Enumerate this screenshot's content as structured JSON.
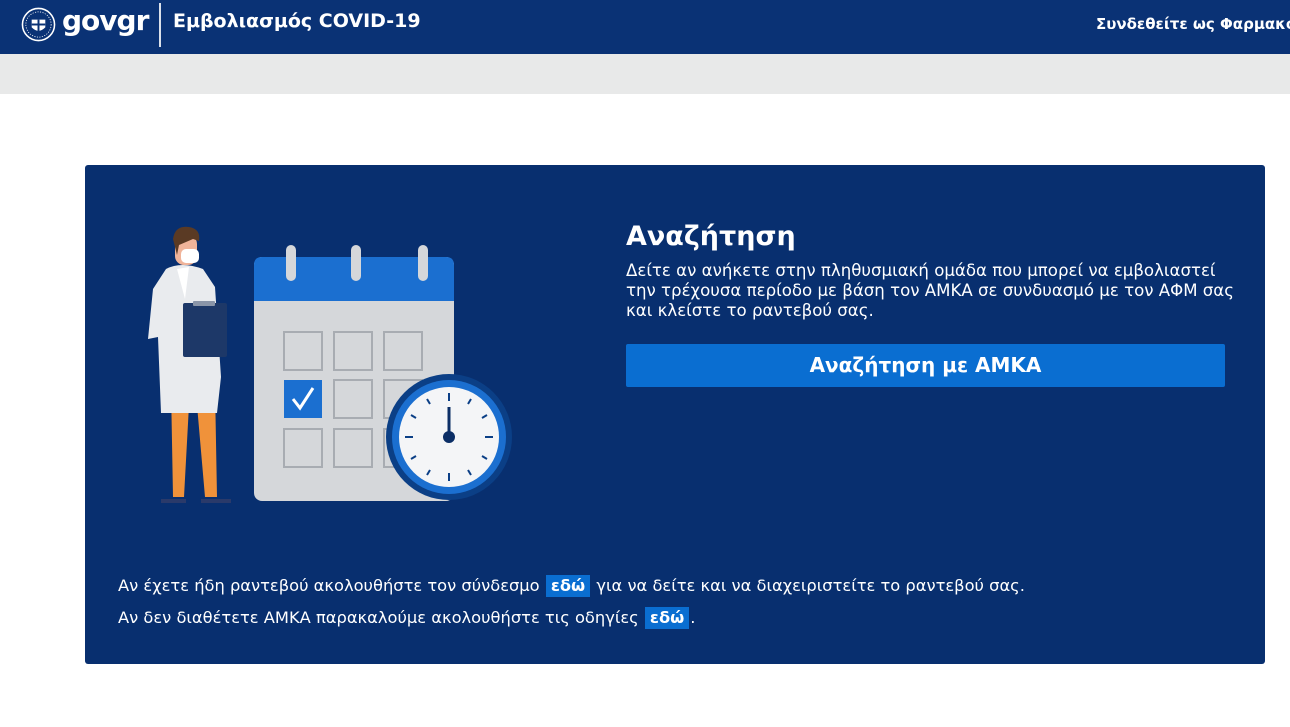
{
  "header": {
    "brand_gov": "gov",
    "brand_gr": "gr",
    "app_title": "Εμβολιασμός COVID-19",
    "user_info": "Συνδεθείτε ως Φαρμακοποιός"
  },
  "search": {
    "title": "Αναζήτηση",
    "description": "Δείτε αν ανήκετε στην πληθυσμιακή ομάδα που μπορεί να εμβολιαστεί την τρέχουσα περίοδο με βάση τον ΑΜΚΑ σε συνδυασμό με τον ΑΦΜ σας και κλείστε το ραντεβού σας.",
    "button_label": "Αναζήτηση με ΑΜΚΑ"
  },
  "info": {
    "line1_before": "Αν έχετε ήδη ραντεβού ακολουθήστε τον σύνδεσμο ",
    "line1_link": "εδώ",
    "line1_after": " για να δείτε και να διαχειριστείτε το ραντεβού σας.",
    "line2_before": "Αν δεν διαθέτετε ΑΜΚΑ παρακαλούμε ακολουθήστε τις οδηγίες ",
    "line2_link": "εδώ",
    "line2_after": "."
  },
  "icons": {
    "emblem": "greek-emblem-icon",
    "illustration": "doctor-calendar-clock-illustration",
    "checkmark": "check-icon",
    "clock": "clock-icon"
  },
  "colors": {
    "header_bg": "#0a3275",
    "card_bg": "#082f6f",
    "accent": "#0a6ed1",
    "subbar_bg": "#e8e9e9"
  }
}
